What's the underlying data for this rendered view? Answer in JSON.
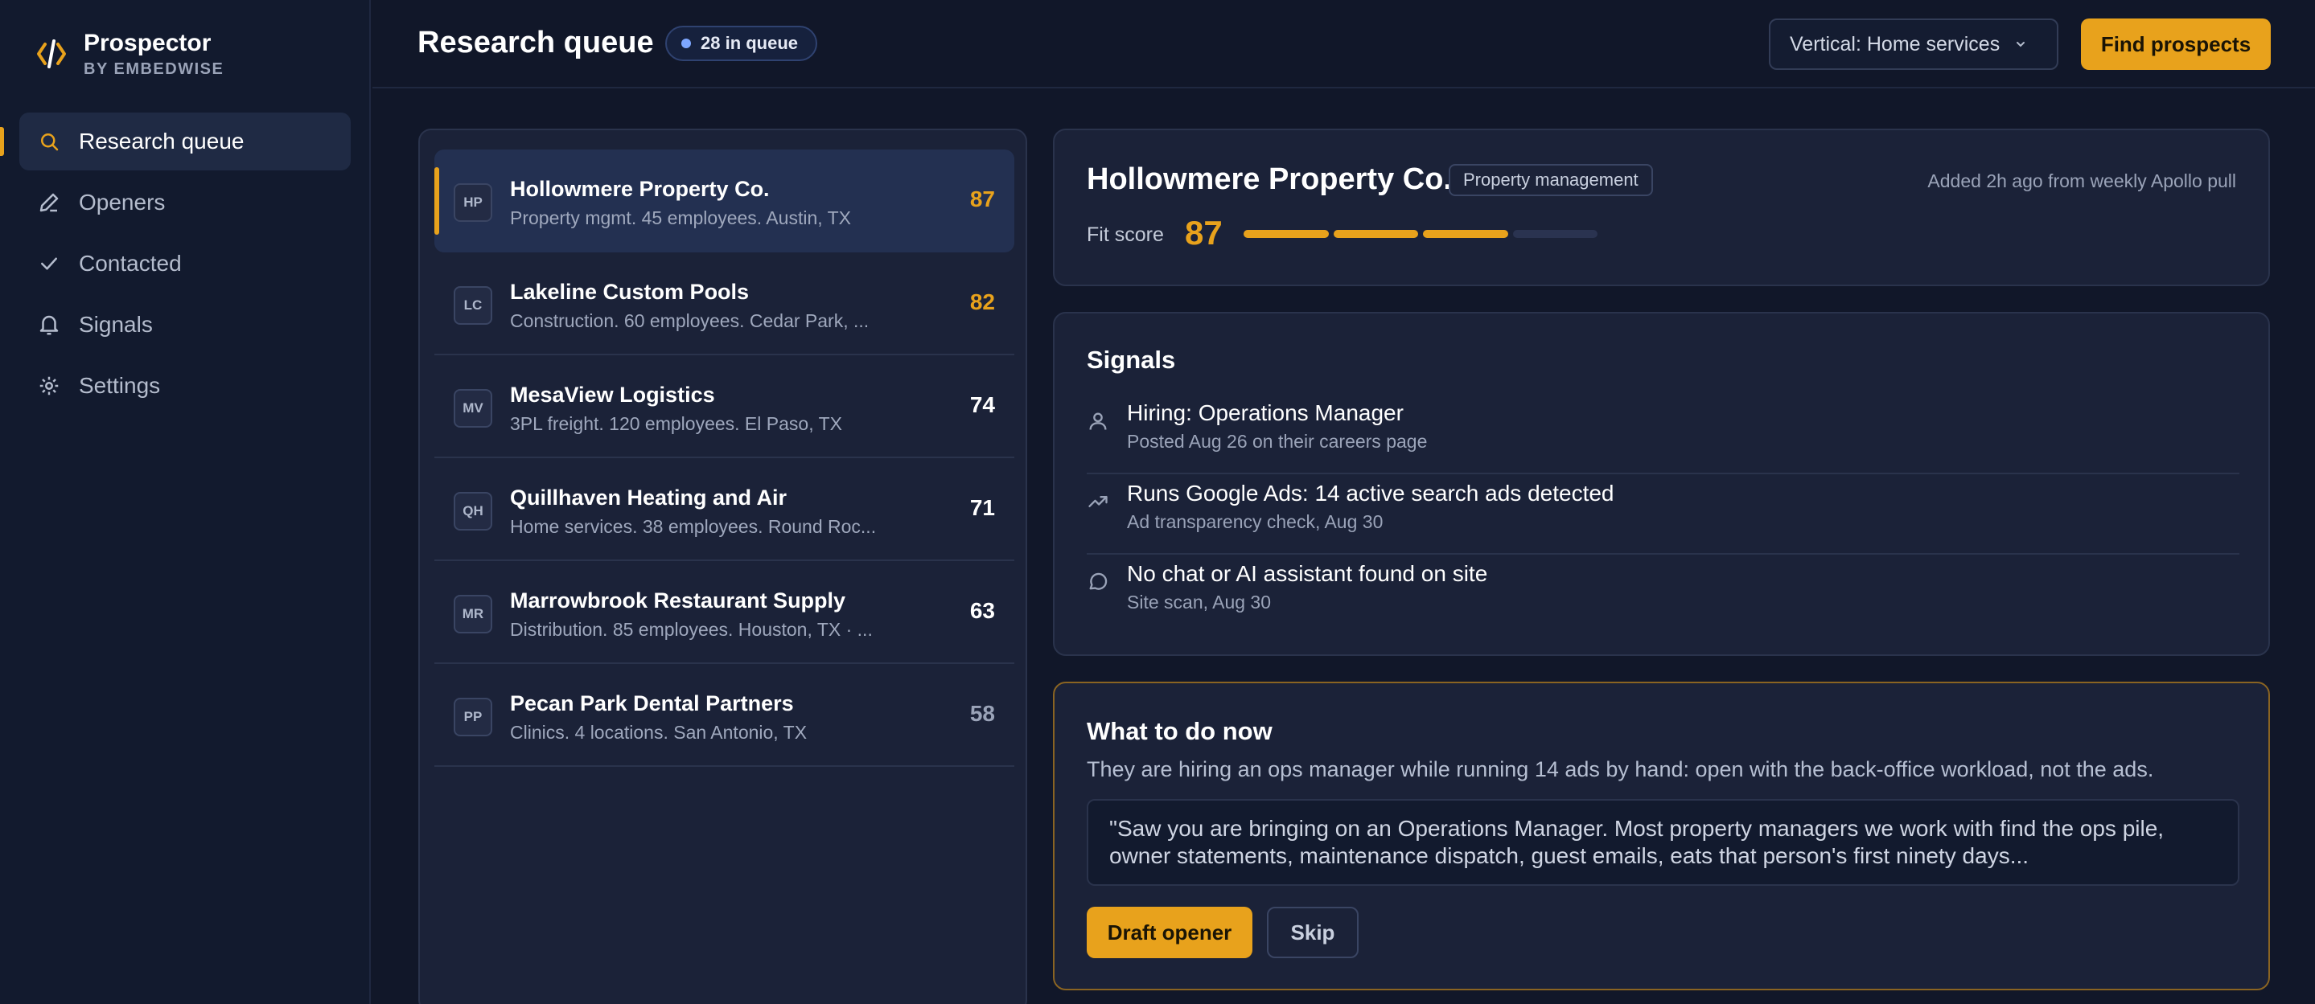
{
  "brand": {
    "name": "Prospector",
    "sub": "BY EMBEDWISE",
    "icon": "code-brackets-logo",
    "accent": "#e8a21c"
  },
  "nav": {
    "items": [
      {
        "label": "Research queue",
        "icon": "search-icon",
        "active": true
      },
      {
        "label": "Openers",
        "icon": "pencil-icon",
        "active": false
      },
      {
        "label": "Contacted",
        "icon": "check-icon",
        "active": false
      },
      {
        "label": "Signals",
        "icon": "bell-icon",
        "active": false
      },
      {
        "label": "Settings",
        "icon": "gear-icon",
        "active": false
      }
    ]
  },
  "header": {
    "title": "Research queue",
    "queue_badge": "28 in queue",
    "vertical_select": "Vertical: Home services",
    "find_button": "Find prospects"
  },
  "queue": [
    {
      "initials": "HP",
      "name": "Hollowmere Property Co.",
      "meta": "Property mgmt. 45 employees. Austin, TX",
      "score": "87",
      "tier": "hi",
      "selected": true
    },
    {
      "initials": "LC",
      "name": "Lakeline Custom Pools",
      "meta": "Construction. 60 employees. Cedar Park, ...",
      "score": "82",
      "tier": "hi",
      "selected": false
    },
    {
      "initials": "MV",
      "name": "MesaView Logistics",
      "meta": "3PL freight. 120 employees. El Paso, TX",
      "score": "74",
      "tier": "mid",
      "selected": false
    },
    {
      "initials": "QH",
      "name": "Quillhaven Heating and Air",
      "meta": "Home services. 38 employees. Round Roc...",
      "score": "71",
      "tier": "mid",
      "selected": false
    },
    {
      "initials": "MR",
      "name": "Marrowbrook Restaurant Supply",
      "meta": "Distribution. 85 employees. Houston, TX · ...",
      "score": "63",
      "tier": "mid",
      "selected": false
    },
    {
      "initials": "PP",
      "name": "Pecan Park Dental Partners",
      "meta": "Clinics. 4 locations. San Antonio, TX",
      "score": "58",
      "tier": "lo",
      "selected": false
    }
  ],
  "company": {
    "name": "Hollowmere Property Co.",
    "tag": "Property management",
    "added": "Added 2h ago from weekly Apollo pull",
    "fit_label": "Fit score",
    "fit_score": "87",
    "fit_segments_filled": 3,
    "fit_segments_total": 4
  },
  "signals": {
    "title": "Signals",
    "items": [
      {
        "icon": "person-icon",
        "title": "Hiring: Operations Manager",
        "sub": "Posted Aug 26 on their careers page"
      },
      {
        "icon": "trend-up-icon",
        "title": "Runs Google Ads: 14 active search ads detected",
        "sub": "Ad transparency check, Aug 30"
      },
      {
        "icon": "chat-bubble-icon",
        "title": "No chat or AI assistant found on site",
        "sub": "Site scan, Aug 30"
      }
    ]
  },
  "action": {
    "title": "What to do now",
    "description": "They are hiring an ops manager while running 14 ads by hand: open with the back-office workload, not the ads.",
    "opener": "\"Saw you are bringing on an Operations Manager. Most property managers we work with find the ops pile, owner statements, maintenance dispatch, guest emails, eats that person's first ninety days...",
    "draft_button": "Draft opener",
    "skip_button": "Skip"
  }
}
